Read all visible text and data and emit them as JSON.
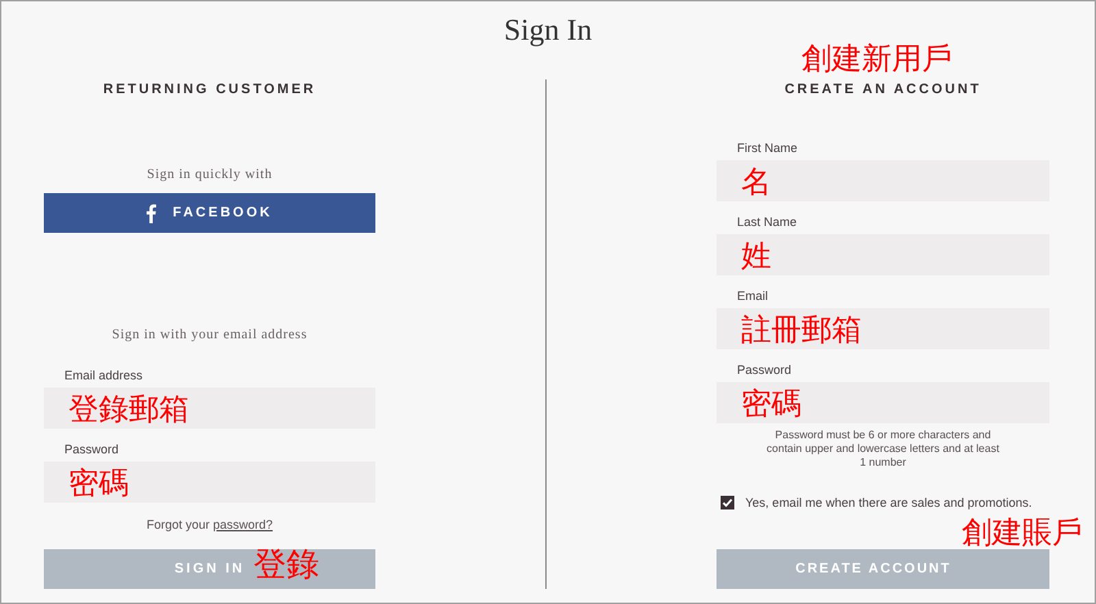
{
  "title": "Sign In",
  "returning": {
    "heading": "RETURNING CUSTOMER",
    "quick_label": "Sign in quickly with",
    "facebook_button": "FACEBOOK",
    "email_intro": "Sign in with your email address",
    "fields": [
      {
        "label": "Email address",
        "value": "登錄郵箱"
      },
      {
        "label": "Password",
        "value": "密碼"
      }
    ],
    "forgot": {
      "text": "Forgot your",
      "link": "password?"
    },
    "submit": {
      "label": "SIGN IN",
      "note": "登錄"
    }
  },
  "create": {
    "note": "創建新用戶",
    "heading": "CREATE AN ACCOUNT",
    "fields": [
      {
        "label": "First Name",
        "value": "名"
      },
      {
        "label": "Last Name",
        "value": "姓"
      },
      {
        "label": "Email",
        "value": "註冊郵箱"
      },
      {
        "label": "Password",
        "value": "密碼"
      }
    ],
    "hint": "Password must be 6 or more characters and contain upper and lowercase letters and at least 1 number",
    "newsletter": {
      "label": "Yes, email me when there are sales and promotions.",
      "checked": true
    },
    "submit": {
      "label": "CREATE ACCOUNT",
      "note": "創建賬戶"
    }
  }
}
